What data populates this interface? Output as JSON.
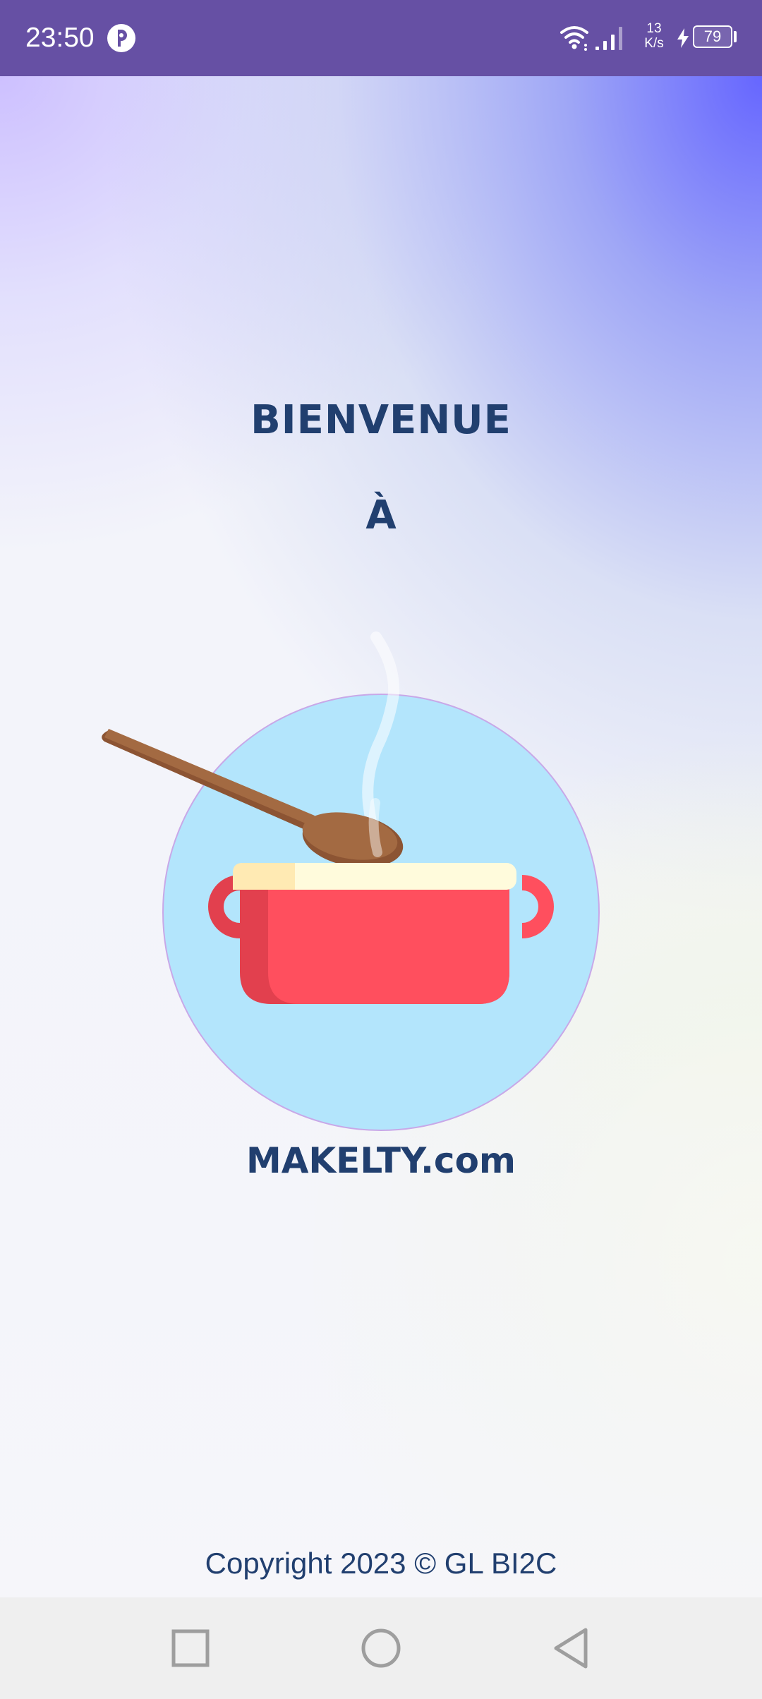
{
  "status_bar": {
    "time": "23:50",
    "net_speed_value": "13",
    "net_speed_unit": "K/s",
    "battery_level": "79",
    "icons": [
      "app-notification-icon",
      "wifi-icon",
      "signal-icon",
      "charging-icon",
      "battery-icon"
    ]
  },
  "welcome": {
    "title": "BIENVENUE",
    "subtitle": "À"
  },
  "logo": {
    "icon": "cooking-pot-with-spoon-icon",
    "colors": {
      "circle": "#b3e5fc",
      "pot": "#ff4f5e",
      "pot_shadow": "#e2404e",
      "lid": "#fffbdc",
      "lid_shadow": "#ffeab3",
      "spoon": "#a36a42"
    }
  },
  "brand": {
    "name": "MAKELTY.com"
  },
  "footer": {
    "copyright": "Copyright 2023 © GL BI2C"
  },
  "nav_bar": {
    "buttons": [
      "recent-apps",
      "home",
      "back"
    ]
  },
  "colors": {
    "status_bar": "#6650a4",
    "text_primary": "#213f6f",
    "nav_bar": "#efefef"
  }
}
